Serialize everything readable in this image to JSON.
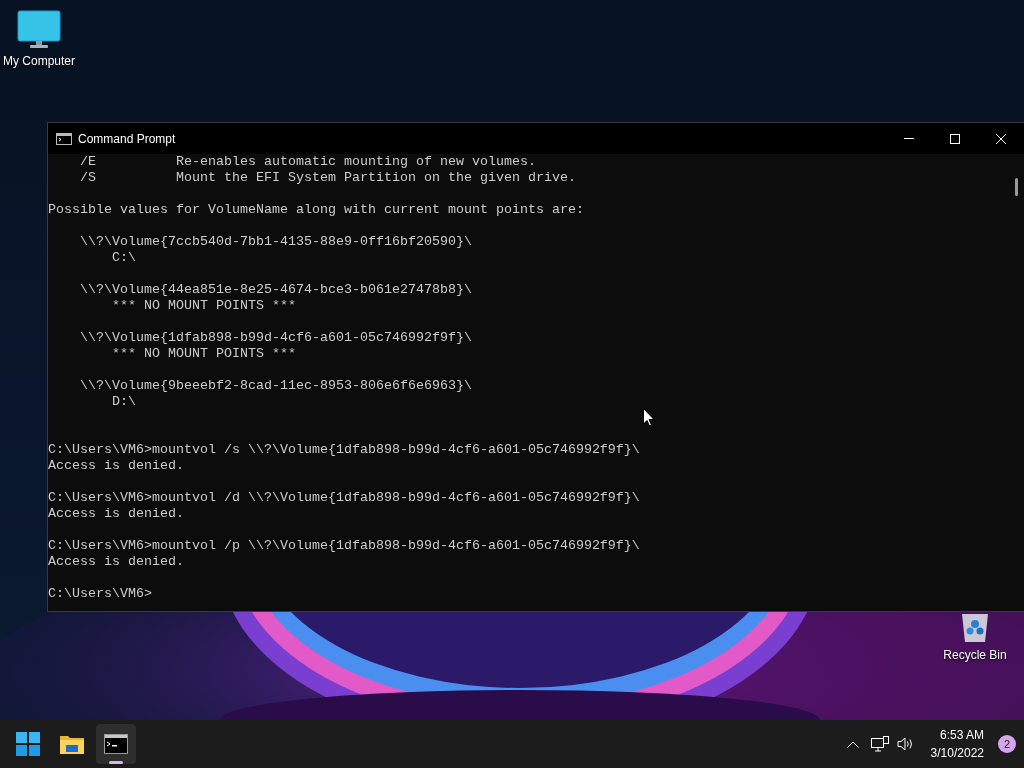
{
  "desktop": {
    "icons": [
      {
        "kind": "computer",
        "label": "My Computer"
      },
      {
        "kind": "recycle",
        "label": "Recycle Bin"
      }
    ]
  },
  "window": {
    "title": "Command Prompt",
    "blocks": [
      {
        "kind": "text",
        "lines": [
          "    /E          Re-enables automatic mounting of new volumes.",
          "    /S          Mount the EFI System Partition on the given drive."
        ]
      },
      {
        "kind": "blank"
      },
      {
        "kind": "text",
        "lines": [
          "Possible values for VolumeName along with current mount points are:"
        ]
      },
      {
        "kind": "blank"
      },
      {
        "kind": "text",
        "lines": [
          "    \\\\?\\Volume{7ccb540d-7bb1-4135-88e9-0ff16bf20590}\\",
          "        C:\\"
        ]
      },
      {
        "kind": "blank"
      },
      {
        "kind": "text",
        "lines": [
          "    \\\\?\\Volume{44ea851e-8e25-4674-bce3-b061e27478b8}\\",
          "        *** NO MOUNT POINTS ***"
        ]
      },
      {
        "kind": "blank"
      },
      {
        "kind": "text",
        "lines": [
          "    \\\\?\\Volume{1dfab898-b99d-4cf6-a601-05c746992f9f}\\",
          "        *** NO MOUNT POINTS ***"
        ]
      },
      {
        "kind": "blank"
      },
      {
        "kind": "text",
        "lines": [
          "    \\\\?\\Volume{9beeebf2-8cad-11ec-8953-806e6f6e6963}\\",
          "        D:\\"
        ]
      },
      {
        "kind": "blank"
      },
      {
        "kind": "blank"
      },
      {
        "kind": "text",
        "lines": [
          "C:\\Users\\VM6>mountvol /s \\\\?\\Volume{1dfab898-b99d-4cf6-a601-05c746992f9f}\\",
          "Access is denied."
        ]
      },
      {
        "kind": "blank"
      },
      {
        "kind": "text",
        "lines": [
          "C:\\Users\\VM6>mountvol /d \\\\?\\Volume{1dfab898-b99d-4cf6-a601-05c746992f9f}\\",
          "Access is denied."
        ]
      },
      {
        "kind": "blank"
      },
      {
        "kind": "text",
        "lines": [
          "C:\\Users\\VM6>mountvol /p \\\\?\\Volume{1dfab898-b99d-4cf6-a601-05c746992f9f}\\",
          "Access is denied."
        ]
      },
      {
        "kind": "blank"
      },
      {
        "kind": "text",
        "lines": [
          "C:\\Users\\VM6>"
        ]
      }
    ]
  },
  "taskbar": {
    "apps": [
      {
        "kind": "start",
        "selected": false
      },
      {
        "kind": "folder",
        "selected": false
      },
      {
        "kind": "terminal",
        "selected": true
      }
    ],
    "time": "6:53 AM",
    "date": "3/10/2022",
    "notifications": "2"
  }
}
